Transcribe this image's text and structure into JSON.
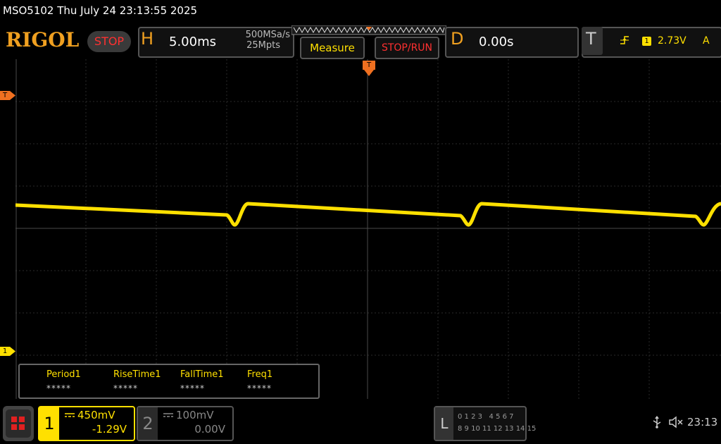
{
  "window": {
    "title": "MSO5102  Thu July 24 23:13:55 2025"
  },
  "toolbar": {
    "logo": "RIGOL",
    "run_state": "STOP",
    "horizontal": {
      "letter": "H",
      "timebase": "5.00ms",
      "sample_rate": "500MSa/s",
      "memory_depth": "25Mpts"
    },
    "measure_label": "Measure",
    "stoprun_label": "STOP/RUN",
    "delay": {
      "letter": "D",
      "value": "0.00s"
    },
    "trigger": {
      "letter": "T",
      "slope_icon": "rising-edge-icon",
      "source": "1",
      "level": "2.73V",
      "mode": "A"
    }
  },
  "markers": {
    "trigger_top": "T",
    "trigger_level": "T",
    "channel1": "1"
  },
  "measurements": {
    "items": [
      {
        "label": "Period1",
        "value": "*****"
      },
      {
        "label": "RiseTime1",
        "value": "*****"
      },
      {
        "label": "FallTime1",
        "value": "*****"
      },
      {
        "label": "Freq1",
        "value": "*****"
      }
    ]
  },
  "channels": [
    {
      "number": "1",
      "coupling": "DC",
      "scale": "450mV",
      "offset": "-1.29V",
      "color": "#ffe000",
      "active": true
    },
    {
      "number": "2",
      "coupling": "DC",
      "scale": "100mV",
      "offset": "0.00V",
      "color": "#888888",
      "active": false
    }
  ],
  "logic": {
    "letter": "L",
    "row1": "0 1 2 3   4 5 6 7",
    "row2": "8 9 10 11 12 13 14 15"
  },
  "status": {
    "clock": "23:13",
    "usb_icon": "usb-icon",
    "sound_icon": "mute-icon"
  },
  "colors": {
    "ch1": "#ffe000",
    "accent": "#f0a020",
    "stop": "#ff3030"
  }
}
